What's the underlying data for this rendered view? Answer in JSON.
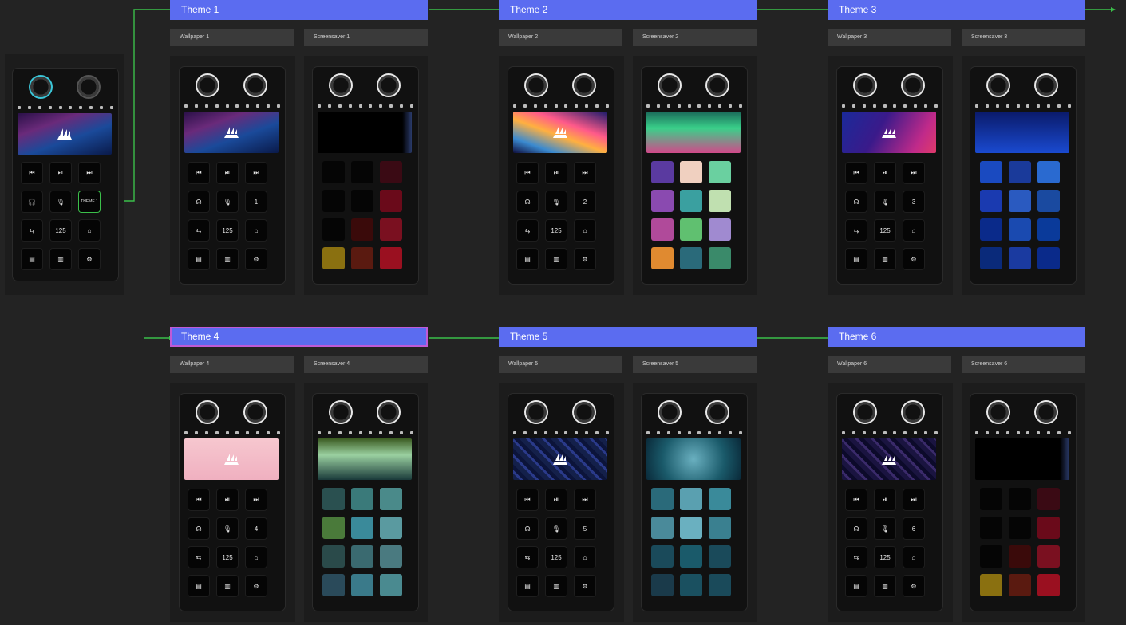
{
  "colors": {
    "theme_bar": "#5b6cf0",
    "connector": "#3bbf4a",
    "background": "#232323"
  },
  "left_device": {
    "keys": [
      "⏮",
      "⏯",
      "⏭",
      "🎧",
      "🎙",
      "THEME 1",
      "⇆",
      "125",
      "⌂",
      "▤",
      "▥",
      "⚙"
    ]
  },
  "themes": [
    {
      "title": "Theme 1",
      "wallpaper": "Wallpaper 1",
      "screensaver": "Screensaver 1",
      "theme_key": "1"
    },
    {
      "title": "Theme 2",
      "wallpaper": "Wallpaper 2",
      "screensaver": "Screensaver 2",
      "theme_key": "2"
    },
    {
      "title": "Theme 3",
      "wallpaper": "Wallpaper 3",
      "screensaver": "Screensaver 3",
      "theme_key": "3"
    },
    {
      "title": "Theme 4",
      "wallpaper": "Wallpaper 4",
      "screensaver": "Screensaver 4",
      "theme_key": "4"
    },
    {
      "title": "Theme 5",
      "wallpaper": "Wallpaper 5",
      "screensaver": "Screensaver 5",
      "theme_key": "5"
    },
    {
      "title": "Theme 6",
      "wallpaper": "Wallpaper 6",
      "screensaver": "Screensaver 6",
      "theme_key": "6"
    }
  ],
  "device_keys": [
    "⏮",
    "⏯",
    "⏭",
    "☊",
    "🎙",
    "THEME",
    "⇆",
    "125",
    "⌂",
    "▤",
    "▥",
    "⚙"
  ],
  "key_icons": [
    "prev-track-icon",
    "play-pause-icon",
    "next-track-icon",
    "headphones-icon",
    "microphone-icon",
    "theme-key",
    "swap-icon",
    "dpi-value",
    "lock-icon",
    "keyboard-icon",
    "display-icon",
    "settings-icon"
  ],
  "styles": {
    "wallpapers": [
      "#3a1a6a",
      "#ff6aa0",
      "#1a2a8a",
      "#f6c7cf",
      "#1a2a5a",
      "#1a1a4a"
    ],
    "screensavers": [
      "#000000",
      "#3aa07a",
      "#1a3a9a",
      "#2a4a30",
      "#1a5a70",
      "#000000"
    ]
  }
}
